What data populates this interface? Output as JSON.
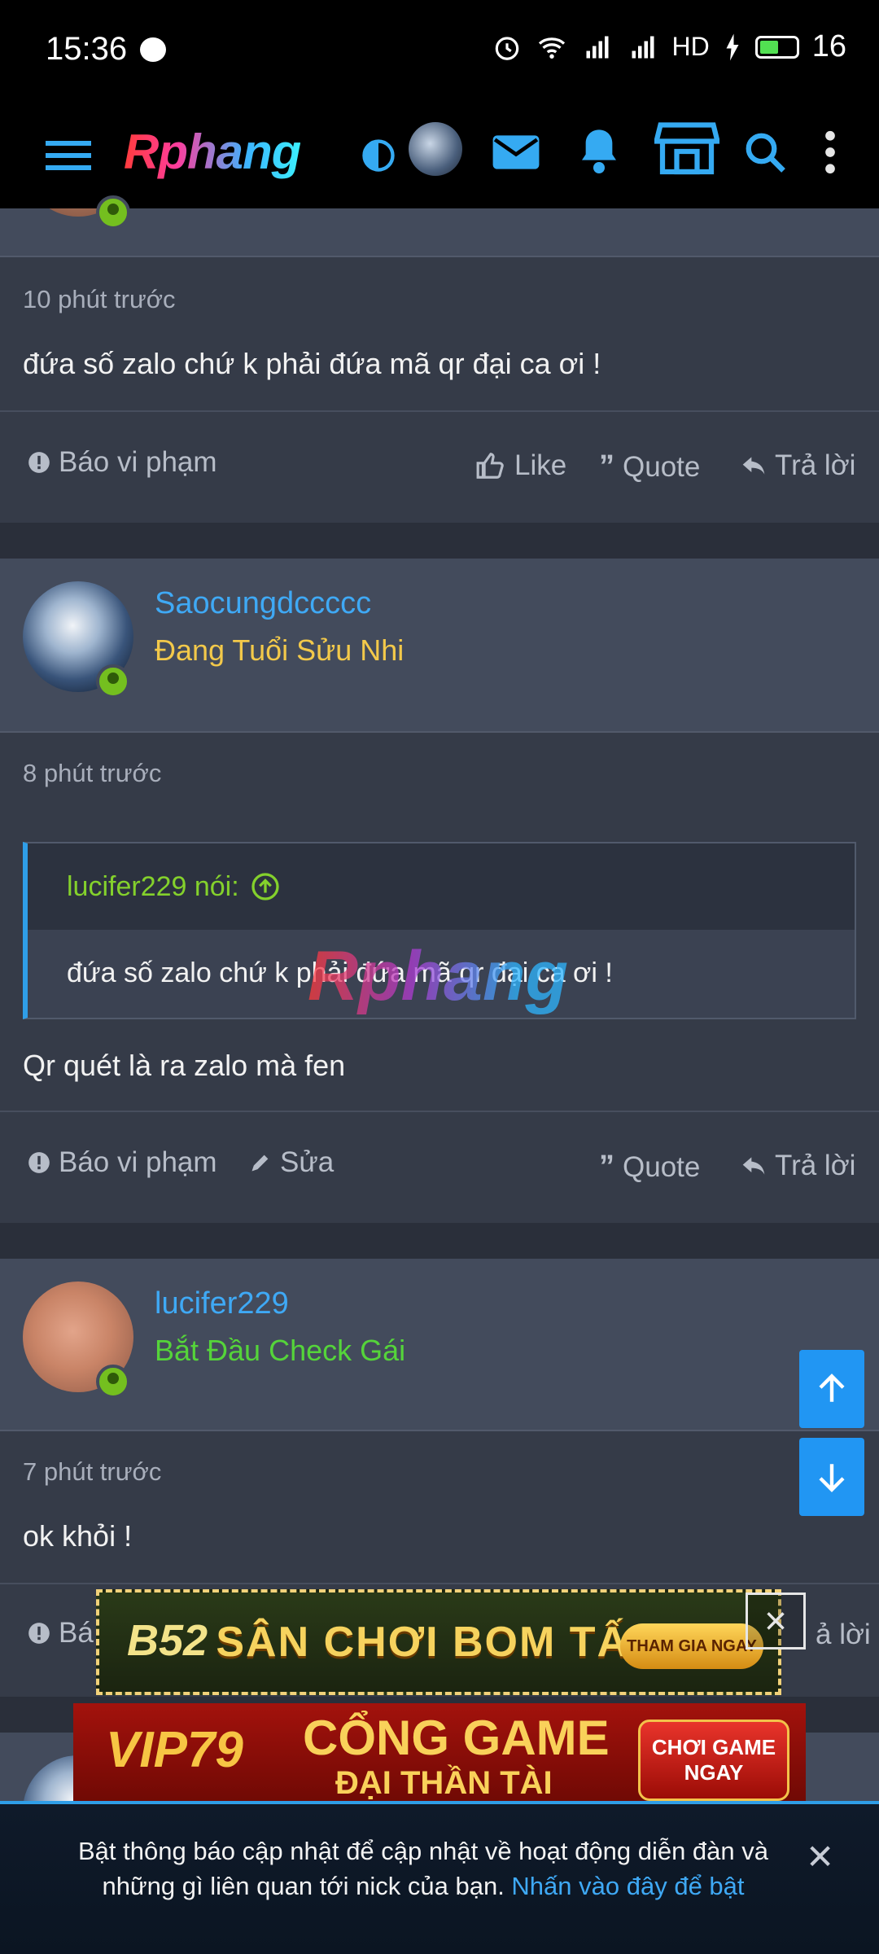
{
  "status_bar": {
    "time": "15:36",
    "battery": "16",
    "network": "HD"
  },
  "header": {
    "logo": "Rphang",
    "menu_icon": "hamburger-icon",
    "theme_icon": "contrast-icon",
    "mail_icon": "mail-icon",
    "bell_icon": "bell-icon",
    "store_icon": "store-icon",
    "search_icon": "search-icon",
    "more_icon": "more-vertical-icon"
  },
  "posts": [
    {
      "time": "10 phút trước",
      "content": "đứa số zalo chứ k phải đứa mã qr đại ca ơi !",
      "actions": {
        "report": "Báo vi phạm",
        "like": "Like",
        "quote": "Quote",
        "reply": "Trả lời"
      }
    },
    {
      "username": "Saocungdccccc",
      "user_title": "Đang Tuổi Sửu Nhi",
      "time": "8 phút trước",
      "quote": {
        "author": "lucifer229 nói:",
        "text": "đứa số zalo chứ k phải đứa mã qr đại ca ơi !"
      },
      "content": "Qr quét là ra zalo mà fen",
      "actions": {
        "report": "Báo vi phạm",
        "edit": "Sửa",
        "quote": "Quote",
        "reply": "Trả lời"
      }
    },
    {
      "username": "lucifer229",
      "user_title": "Bắt Đầu Check Gái",
      "time": "7 phút trước",
      "content": "ok khỏi !",
      "actions": {
        "report": "Bá",
        "reply": "ả lời"
      }
    }
  ],
  "watermark": "Rphang",
  "ads": {
    "ad1": {
      "logo": "B52",
      "text": "SÂN CHƠI BOM TẤN",
      "button": "THAM GIA NGAY"
    },
    "ad2": {
      "logo": "VIP79",
      "line1": "CỔNG GAME",
      "line2": "ĐẠI THẦN TÀI",
      "button_line1": "CHƠI GAME",
      "button_line2": "NGAY"
    }
  },
  "notice": {
    "text": "Bật thông báo cập nhật để cập nhật về hoạt động diễn đàn và những gì liên quan tới nick của bạn. ",
    "link": "Nhấn vào đây để bật"
  },
  "colors": {
    "accent": "#3fa9f5",
    "title_gold": "#f3c94a",
    "title_green": "#55d43a",
    "online": "#74bf1f"
  }
}
